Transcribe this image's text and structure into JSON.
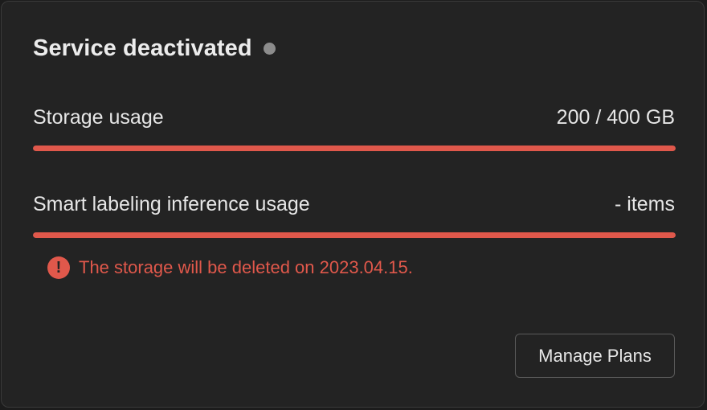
{
  "header": {
    "title": "Service deactivated",
    "status_icon": "status-dot-icon",
    "status_color": "#8c8c8c"
  },
  "usage": [
    {
      "label": "Storage usage",
      "value": "200 / 400 GB",
      "bar_fill_percent": 100
    },
    {
      "label": "Smart labeling inference usage",
      "value": "- items",
      "bar_fill_percent": 100
    }
  ],
  "warning": {
    "icon": "exclamation-circle-icon",
    "icon_glyph": "!",
    "text": "The storage will be deleted on 2023.04.15."
  },
  "actions": {
    "manage_label": "Manage Plans"
  },
  "colors": {
    "accent": "#e0584b",
    "background": "#232323",
    "text": "#e8e8e8"
  }
}
